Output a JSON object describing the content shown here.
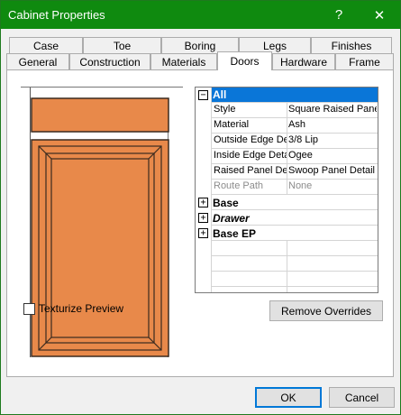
{
  "window": {
    "title": "Cabinet Properties",
    "help_glyph": "?",
    "close_glyph": "✕"
  },
  "tabs_back": [
    "Case",
    "Toe",
    "Boring",
    "Legs",
    "Finishes"
  ],
  "tabs_front": [
    "General",
    "Construction",
    "Materials",
    "Doors",
    "Hardware",
    "Frame"
  ],
  "active_tab": "Doors",
  "colors": {
    "door_fill": "#e8894a",
    "door_edge": "#3a2a1f",
    "selection": "#0a76d8",
    "titlebar": "#0f8a0f"
  },
  "grid": {
    "categories": [
      {
        "label": "All",
        "expander": "−",
        "selected": true
      },
      {
        "label": "Base",
        "expander": "+"
      },
      {
        "label": "Drawer",
        "expander": "+"
      },
      {
        "label": "Base EP",
        "expander": "+"
      }
    ],
    "properties": [
      {
        "name": "Style",
        "value": "Square Raised Panel",
        "disabled": false
      },
      {
        "name": "Material",
        "value": "Ash",
        "disabled": false
      },
      {
        "name": "Outside Edge Detail",
        "value": "3/8 Lip",
        "disabled": false
      },
      {
        "name": "Inside Edge Detail",
        "value": "Ogee",
        "disabled": false
      },
      {
        "name": "Raised Panel Detail",
        "value": "Swoop Panel Detail",
        "disabled": false
      },
      {
        "name": "Route Path",
        "value": "None",
        "disabled": true
      }
    ]
  },
  "texturize_label": "Texturize Preview",
  "texturize_checked": false,
  "remove_overrides_label": "Remove Overrides",
  "ok_label": "OK",
  "cancel_label": "Cancel"
}
